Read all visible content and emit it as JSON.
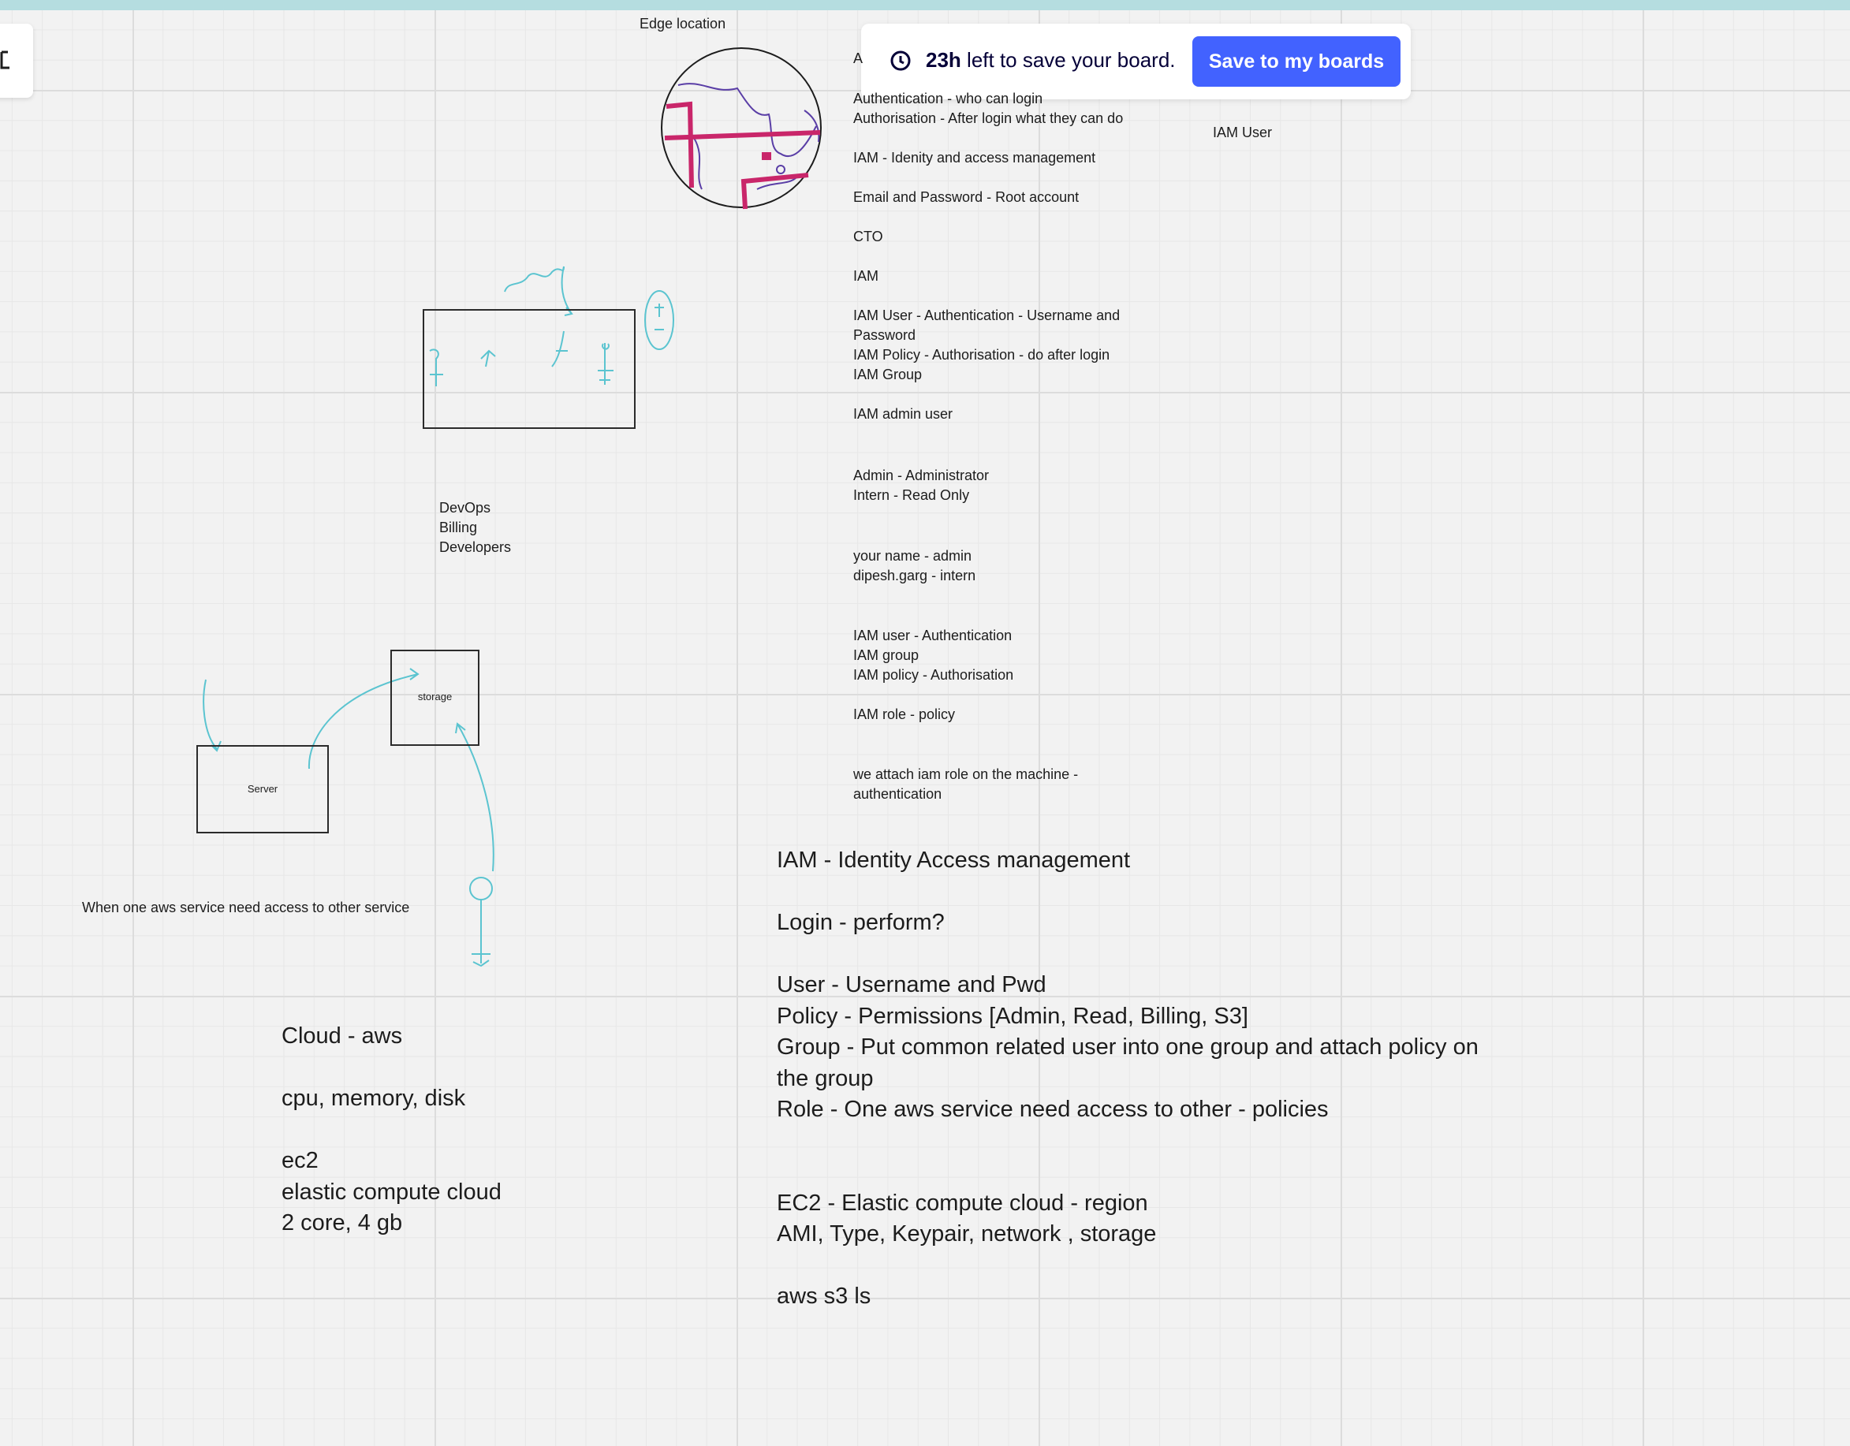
{
  "banner": {
    "hours": "23h",
    "message_rest": " left to save your board.",
    "save_button": "Save to my boards"
  },
  "board": {
    "edge_location_label": "Edge location",
    "iam_user_label": "IAM User",
    "notes_partial_first": "A",
    "notes": "Authentication - who can login\nAuthorisation - After login what they can do\n\nIAM - Idenity and access management\n\nEmail and Password - Root account\n\nCTO\n\nIAM\n\nIAM User - Authentication - Username and\nPassword\nIAM Policy - Authorisation - do after login\nIAM Group\n\nIAM admin user",
    "roles_note": "Admin - Administrator\nIntern - Read Only",
    "users_note": "your name - admin\ndipesh.garg - intern",
    "iam_summary_note": "IAM user - Authentication\nIAM group\nIAM policy - Authorisation\n\nIAM role - policy",
    "attach_role_note": "we attach iam role on the machine -\nauthentication",
    "groups_note": "DevOps\nBilling\nDevelopers",
    "storage_label": "storage",
    "server_label": "Server",
    "service_access_note": "When one aws service need access to other service",
    "cloud_note": "Cloud - aws\n\ncpu, memory, disk\n\nec2\nelastic compute cloud\n2 core, 4 gb",
    "iam_note": "IAM - Identity Access management\n\nLogin - perform?\n\nUser - Username and Pwd\nPolicy - Permissions [Admin, Read, Billing, S3]\nGroup - Put common related user into one group and attach policy on\nthe group\nRole - One aws service need access to other - policies\n\n\nEC2 - Elastic compute cloud - region\nAMI, Type, Keypair, network , storage\n\naws s3 ls"
  },
  "icons": {
    "clock": "clock-icon",
    "undo": "undo-icon"
  },
  "colors": {
    "accent": "#4262ff",
    "ink_cyan": "#5bc4d0",
    "ink_magenta": "#c9266a",
    "ink_purple": "#5a3ea6",
    "top_bar": "#b5dde0"
  }
}
